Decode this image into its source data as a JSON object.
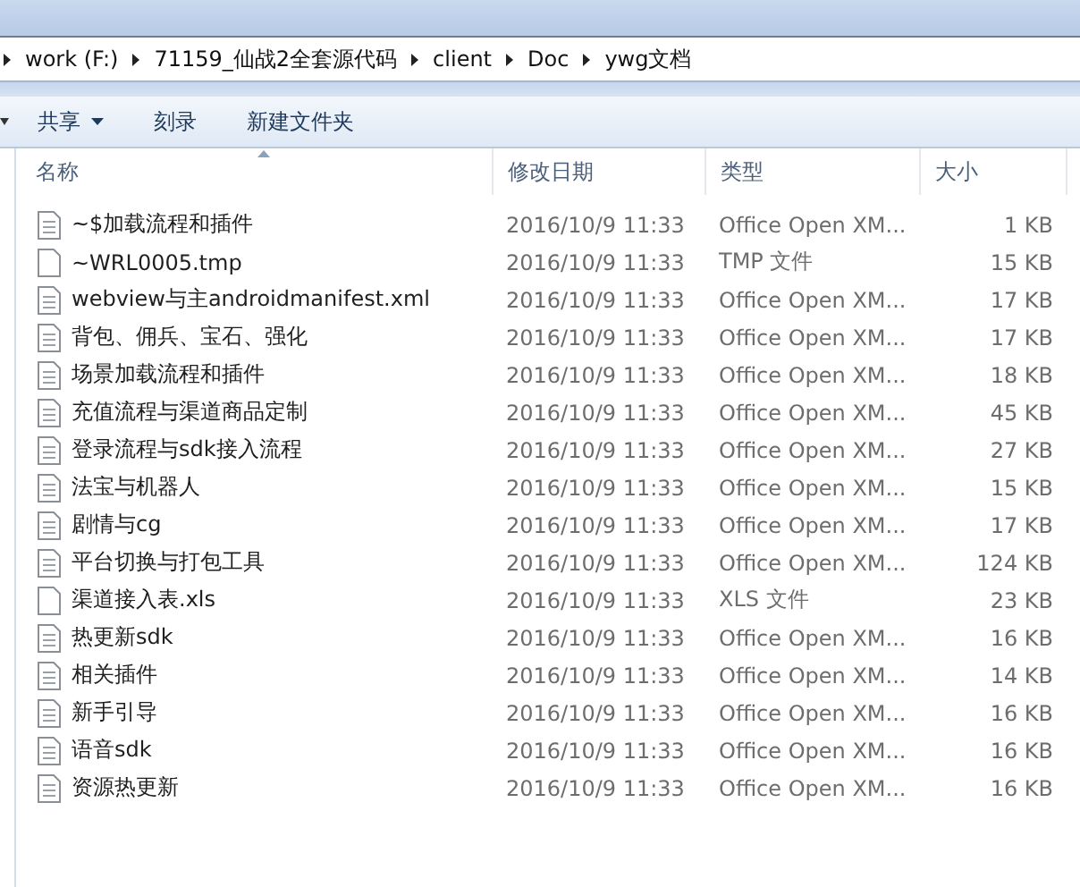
{
  "breadcrumb": [
    "work (F:)",
    "71159_仙战2全套源代码",
    "client",
    "Doc",
    "ywg文档"
  ],
  "toolbar": [
    {
      "label": "共享",
      "dropdown": true
    },
    {
      "label": "刻录",
      "dropdown": false
    },
    {
      "label": "新建文件夹",
      "dropdown": false
    }
  ],
  "columns": [
    {
      "label": "名称",
      "sorted": true
    },
    {
      "label": "修改日期",
      "sorted": false
    },
    {
      "label": "类型",
      "sorted": false
    },
    {
      "label": "大小",
      "sorted": false
    }
  ],
  "rows": [
    {
      "name": "~$加载流程和插件",
      "date": "2016/10/9 11:33",
      "type": "Office Open XM...",
      "size": "1 KB",
      "kind": "doc"
    },
    {
      "name": "~WRL0005.tmp",
      "date": "2016/10/9 11:33",
      "type": "TMP 文件",
      "size": "15 KB",
      "kind": "blank"
    },
    {
      "name": "webview与主androidmanifest.xml",
      "date": "2016/10/9 11:33",
      "type": "Office Open XM...",
      "size": "17 KB",
      "kind": "doc"
    },
    {
      "name": "背包、佣兵、宝石、强化",
      "date": "2016/10/9 11:33",
      "type": "Office Open XM...",
      "size": "17 KB",
      "kind": "doc"
    },
    {
      "name": "场景加载流程和插件",
      "date": "2016/10/9 11:33",
      "type": "Office Open XM...",
      "size": "18 KB",
      "kind": "doc"
    },
    {
      "name": "充值流程与渠道商品定制",
      "date": "2016/10/9 11:33",
      "type": "Office Open XM...",
      "size": "45 KB",
      "kind": "doc"
    },
    {
      "name": "登录流程与sdk接入流程",
      "date": "2016/10/9 11:33",
      "type": "Office Open XM...",
      "size": "27 KB",
      "kind": "doc"
    },
    {
      "name": "法宝与机器人",
      "date": "2016/10/9 11:33",
      "type": "Office Open XM...",
      "size": "15 KB",
      "kind": "doc"
    },
    {
      "name": "剧情与cg",
      "date": "2016/10/9 11:33",
      "type": "Office Open XM...",
      "size": "17 KB",
      "kind": "doc"
    },
    {
      "name": "平台切换与打包工具",
      "date": "2016/10/9 11:33",
      "type": "Office Open XM...",
      "size": "124 KB",
      "kind": "doc"
    },
    {
      "name": "渠道接入表.xls",
      "date": "2016/10/9 11:33",
      "type": "XLS 文件",
      "size": "23 KB",
      "kind": "blank"
    },
    {
      "name": "热更新sdk",
      "date": "2016/10/9 11:33",
      "type": "Office Open XM...",
      "size": "16 KB",
      "kind": "doc"
    },
    {
      "name": "相关插件",
      "date": "2016/10/9 11:33",
      "type": "Office Open XM...",
      "size": "14 KB",
      "kind": "doc"
    },
    {
      "name": "新手引导",
      "date": "2016/10/9 11:33",
      "type": "Office Open XM...",
      "size": "16 KB",
      "kind": "doc"
    },
    {
      "name": "语音sdk",
      "date": "2016/10/9 11:33",
      "type": "Office Open XM...",
      "size": "16 KB",
      "kind": "doc"
    },
    {
      "name": "资源热更新",
      "date": "2016/10/9 11:33",
      "type": "Office Open XM...",
      "size": "16 KB",
      "kind": "doc"
    }
  ]
}
